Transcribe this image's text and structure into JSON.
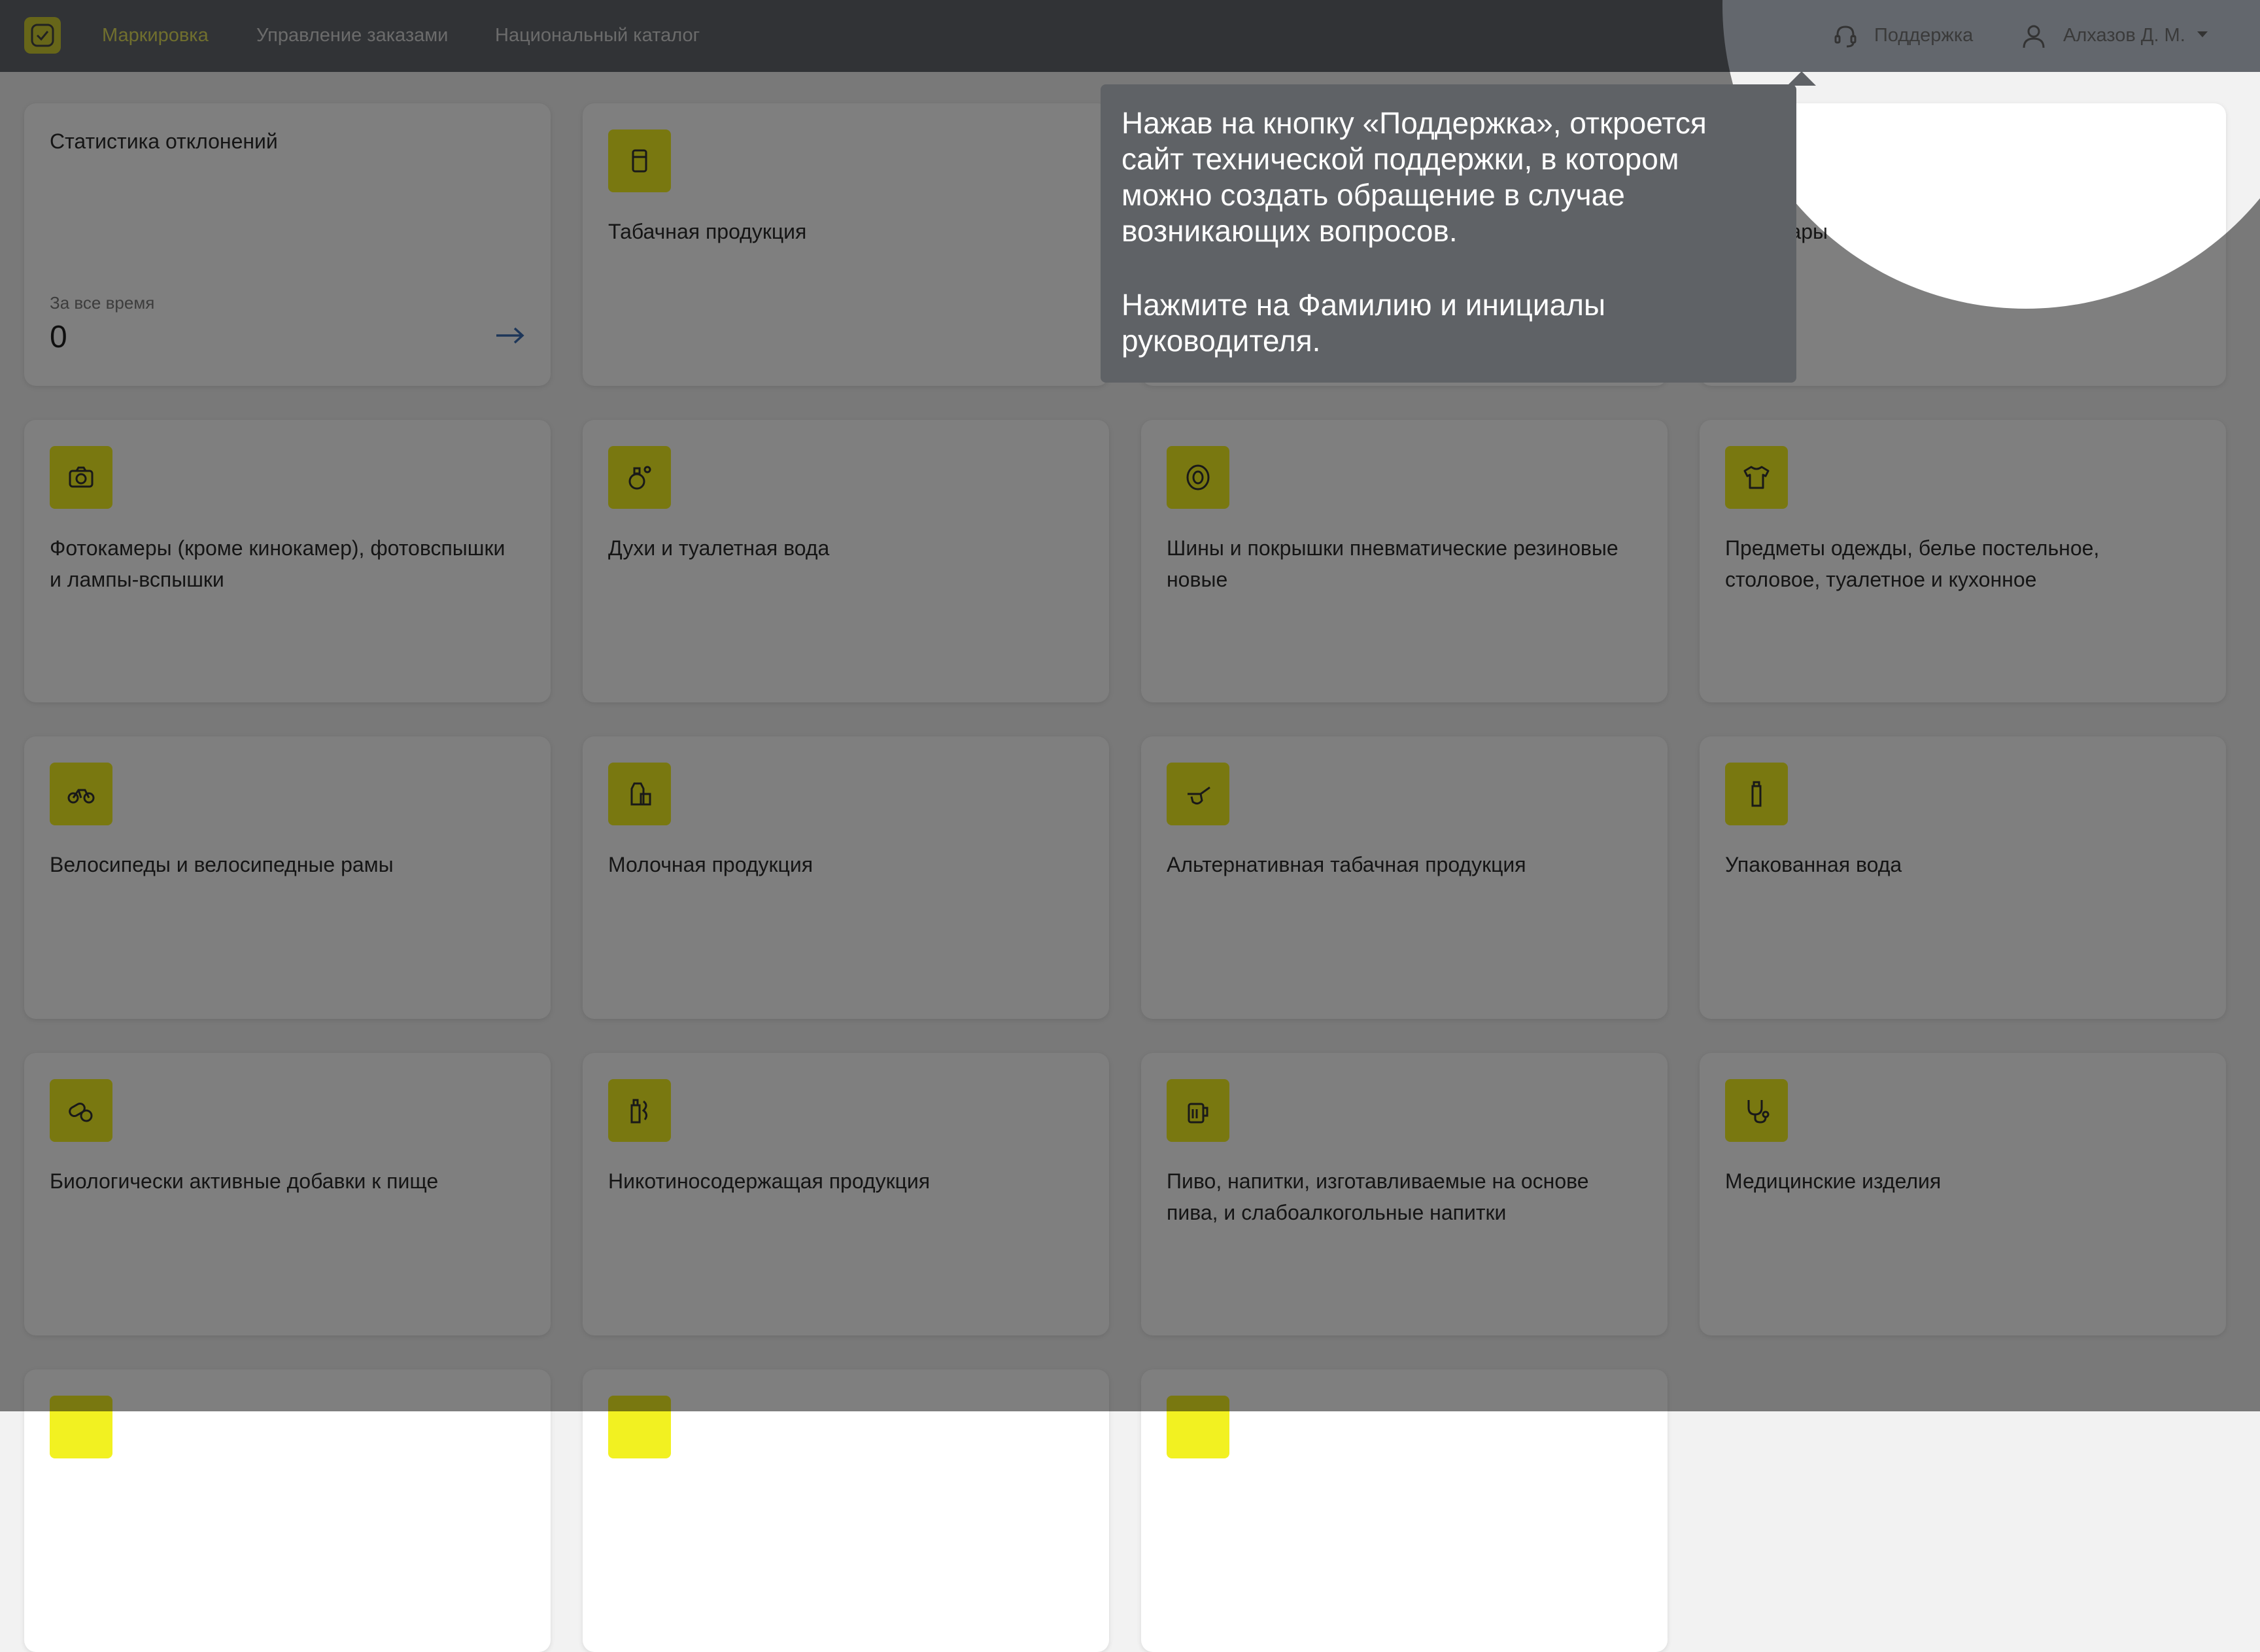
{
  "header": {
    "nav": [
      "Маркировка",
      "Управление заказами",
      "Национальный каталог"
    ],
    "support_label": "Поддержка",
    "user_label": "Алхазов Д. М."
  },
  "stats_card": {
    "title": "Статистика отклонений",
    "caption": "За все время",
    "value": "0"
  },
  "cards": [
    {
      "title": "Табачная продукция",
      "icon": "cigarette-pack-icon"
    },
    {
      "title": "",
      "icon": ""
    },
    {
      "title": "ые товары",
      "icon": ""
    },
    {
      "title": "Фотокамеры (кроме кинокамер), фотовспышки и лампы-вспышки",
      "icon": "camera-icon"
    },
    {
      "title": "Духи и туалетная вода",
      "icon": "perfume-icon"
    },
    {
      "title": "Шины и покрышки пневматические резиновые новые",
      "icon": "tire-icon"
    },
    {
      "title": "Предметы одежды, белье постельное, столовое, туалетное и кухонное",
      "icon": "tshirt-icon"
    },
    {
      "title": "Велосипеды и велосипедные рамы",
      "icon": "bicycle-icon"
    },
    {
      "title": "Молочная продукция",
      "icon": "milk-icon"
    },
    {
      "title": "Альтернативная табачная продукция",
      "icon": "pipe-icon"
    },
    {
      "title": "Упакованная вода",
      "icon": "water-bottle-icon"
    },
    {
      "title": "Биологически активные добавки к пище",
      "icon": "supplement-icon"
    },
    {
      "title": "Никотиносодержащая продукция",
      "icon": "vape-icon"
    },
    {
      "title": "Пиво, напитки, изготавливаемые на основе пива, и слабоалкогольные напитки",
      "icon": "beer-icon"
    },
    {
      "title": "Медицинские изделия",
      "icon": "stethoscope-icon"
    }
  ],
  "tooltip": {
    "paragraph1": "Нажав на кнопку «Поддержка», откроется сайт технической поддержки, в котором можно создать обращение в случае возникающих вопросов.",
    "paragraph2": "Нажмите на Фамилию и инициалы руководителя."
  },
  "colors": {
    "accent_yellow": "#f2f121",
    "header_bg": "#2d3137",
    "active_nav": "#c9c73a"
  }
}
